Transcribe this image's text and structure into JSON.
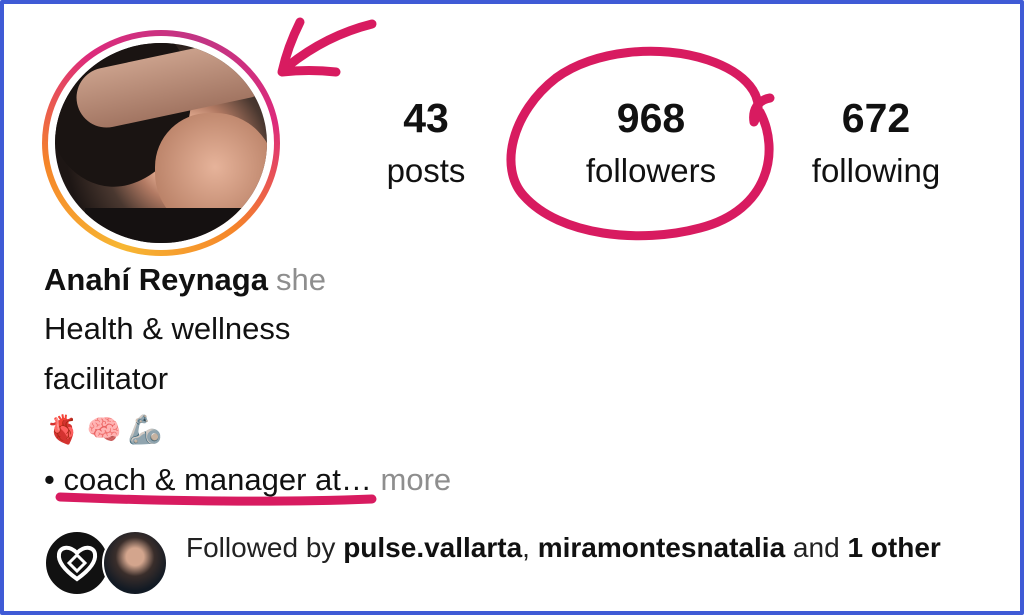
{
  "profile": {
    "name": "Anahí Reynaga",
    "pronoun": "she",
    "bio_line_1": "Health & wellness",
    "bio_line_2": "facilitator",
    "emojis": [
      "🫀",
      "🧠",
      "🦾"
    ],
    "bio_link_prefix": "• ",
    "bio_link_text": "coach & manager at",
    "bio_ellipsis": "…",
    "more_label": " more"
  },
  "stats": {
    "posts": {
      "value": "43",
      "label": "posts"
    },
    "followers": {
      "value": "968",
      "label": "followers"
    },
    "following": {
      "value": "672",
      "label": "following"
    }
  },
  "followed_by": {
    "prefix": "Followed by ",
    "user_1": "pulse.vallarta",
    "separator": ", ",
    "user_2": "miramontesnatalia",
    "conjunction": " and ",
    "others_count": "1",
    "others_label": "other"
  },
  "colors": {
    "annotation": "#d81b60",
    "frame": "#3f5bd6",
    "secondary_text": "#8e8e8e"
  }
}
